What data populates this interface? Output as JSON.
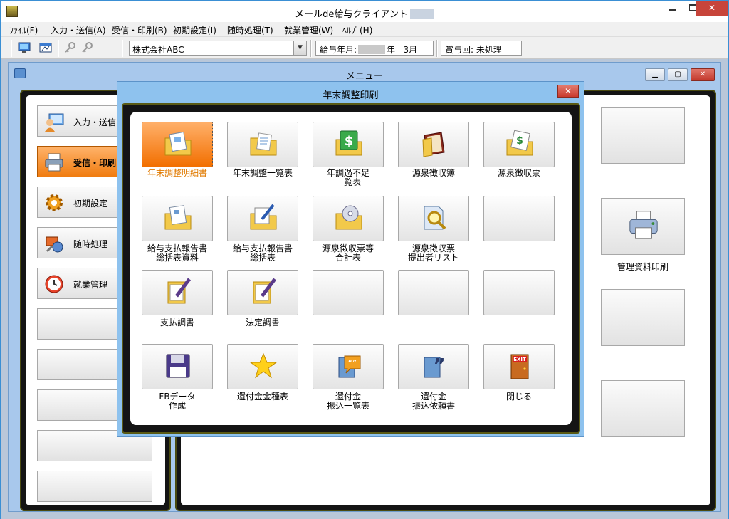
{
  "app": {
    "title": "メールde給与クライアント"
  },
  "menubar": [
    "ﾌｧｲﾙ(F)",
    "入力・送信(A)",
    "受信・印刷(B)",
    "初期設定(I)",
    "随時処理(T)",
    "就業管理(W)",
    "ﾍﾙﾌﾟ(H)"
  ],
  "toolbar": {
    "company": "株式会社ABC",
    "pay_month_label": "給与年月:",
    "pay_month_year_suffix": "年",
    "pay_month_month": "3月",
    "bonus_label": "賞与回:",
    "bonus_value": "未処理"
  },
  "menu_window": {
    "title": "メニュー",
    "side_items": [
      {
        "label": "入力・送信",
        "icon": "user-monitor-icon",
        "active": false
      },
      {
        "label": "受信・印刷",
        "icon": "printer-icon",
        "active": true
      },
      {
        "label": "初期設定",
        "icon": "gear-icon",
        "active": false
      },
      {
        "label": "随時処理",
        "icon": "tools-icon",
        "active": false
      },
      {
        "label": "就業管理",
        "icon": "clock-icon",
        "active": false
      },
      {
        "label": "",
        "icon": "",
        "active": false
      },
      {
        "label": "",
        "icon": "",
        "active": false
      },
      {
        "label": "",
        "icon": "",
        "active": false
      },
      {
        "label": "",
        "icon": "",
        "active": false
      },
      {
        "label": "",
        "icon": "",
        "active": false
      }
    ],
    "right_buttons": [
      {
        "label": ""
      },
      {
        "label": "管理資料印刷",
        "icon": "printer-icon"
      },
      {
        "label": ""
      },
      {
        "label": ""
      }
    ]
  },
  "dialog": {
    "title": "年末調整印刷",
    "tiles": [
      {
        "label": "年末調整明細書",
        "icon": "folder-document-icon",
        "active": true
      },
      {
        "label": "年末調整一覧表",
        "icon": "folder-open-icon",
        "active": false
      },
      {
        "label": "年調過不足\n一覧表",
        "icon": "money-folder-icon",
        "active": false
      },
      {
        "label": "源泉徴収簿",
        "icon": "ledger-book-icon",
        "active": false
      },
      {
        "label": "源泉徴収票",
        "icon": "money-paper-folder-icon",
        "active": false
      },
      {
        "label": "給与支払報告書\n総括表資料",
        "icon": "folder-paper-icon",
        "active": false
      },
      {
        "label": "給与支払報告書\n総括表",
        "icon": "folder-pen-icon",
        "active": false
      },
      {
        "label": "源泉徴収票等\n合計表",
        "icon": "folder-disc-icon",
        "active": false
      },
      {
        "label": "源泉徴収票\n提出者リスト",
        "icon": "document-search-icon",
        "active": false
      },
      {
        "label": "",
        "icon": "",
        "active": false
      },
      {
        "label": "支払調書",
        "icon": "clipboard-pen-icon",
        "active": false
      },
      {
        "label": "法定調書",
        "icon": "clipboard-pen-icon",
        "active": false
      },
      {
        "label": "",
        "icon": "",
        "active": false
      },
      {
        "label": "",
        "icon": "",
        "active": false
      },
      {
        "label": "",
        "icon": "",
        "active": false
      },
      {
        "label": "FBデータ\n作成",
        "icon": "floppy-disk-icon",
        "active": false
      },
      {
        "label": "還付金金種表",
        "icon": "star-icon",
        "active": false
      },
      {
        "label": "還付金\n振込一覧表",
        "icon": "speech-bubble-icon",
        "active": false
      },
      {
        "label": "還付金\n振込依頼書",
        "icon": "quote-icon",
        "active": false
      },
      {
        "label": "閉じる",
        "icon": "exit-door-icon",
        "active": false
      }
    ]
  }
}
